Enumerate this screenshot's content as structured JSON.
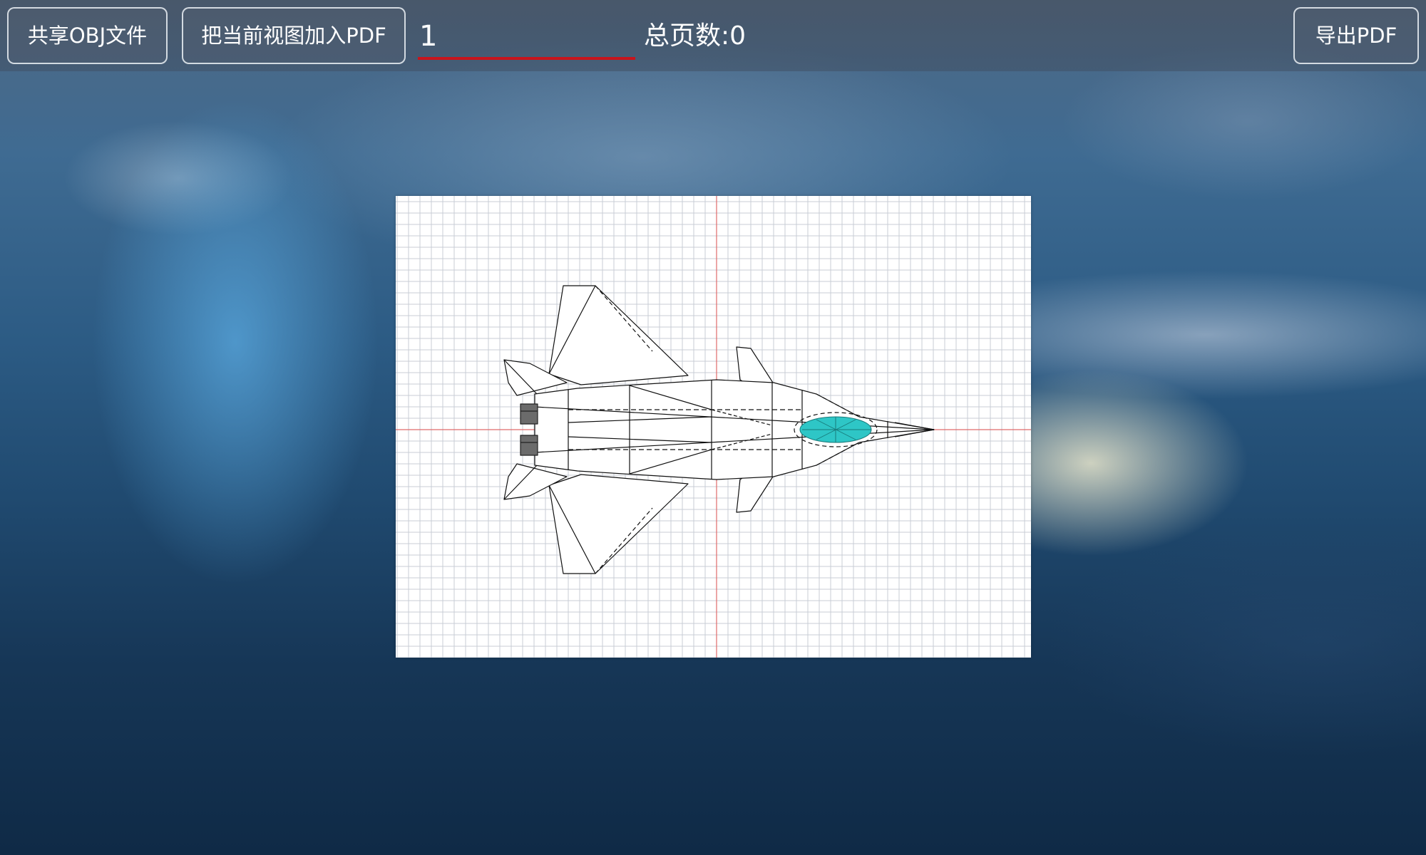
{
  "toolbar": {
    "share_obj_label": "共享OBJ文件",
    "add_view_label": "把当前视图加入PDF",
    "page_input_value": "1",
    "page_count_text": "总页数:0",
    "export_pdf_label": "导出PDF"
  },
  "preview": {
    "model_icon": "fighter-jet-wireframe-icon",
    "grid_color": "#c9cdd6",
    "axis_color": "#e06a6a",
    "canopy_color": "#2ec6c6"
  },
  "colors": {
    "underline_accent": "#c8141c",
    "button_border": "#ebf0f5"
  }
}
